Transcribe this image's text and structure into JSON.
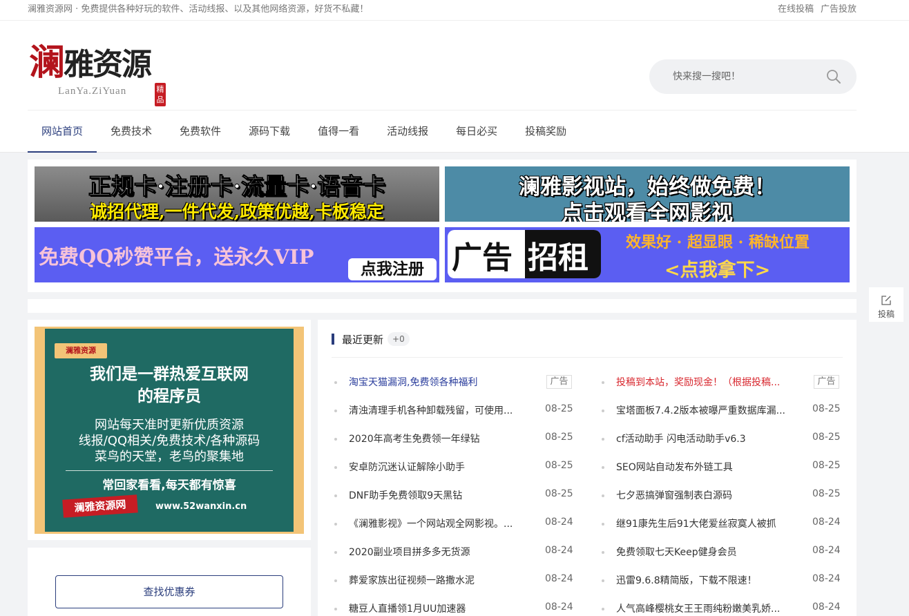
{
  "topbar": {
    "tagline": "澜雅资源网 · 免费提供各种好玩的软件、活动线报、以及其他网络资源，好货不私藏！",
    "links": [
      "在线投稿",
      "广告投放"
    ]
  },
  "logo": {
    "main_red": "澜",
    "main_rest": "雅资源",
    "sub": "LanYa.ZiYuan",
    "seal": "精品"
  },
  "search": {
    "placeholder": "快来搜一搜吧！"
  },
  "nav": [
    "网站首页",
    "免费技术",
    "免费软件",
    "源码下载",
    "值得一看",
    "活动线报",
    "每日必买",
    "投稿奖励"
  ],
  "banners": {
    "b1": {
      "line1": "正规卡·注册卡·流量卡·语音卡",
      "line2": "诚招代理,一件代发,政策优越,卡板稳定"
    },
    "b2": {
      "line1": "澜雅影视站，始终做免费！",
      "line2": "点击观看全网影视"
    },
    "b3": {
      "line1": "免费QQ秒赞平台，送永久VIP",
      "button": "点我注册"
    },
    "b4": {
      "t1": "广告",
      "t2": "招租",
      "r1": "效果好 · 超显眼 · 稀缺位置",
      "r2": "<点我拿下>"
    }
  },
  "promo": {
    "mini": "澜雅资源",
    "heading1": "我们是一群热爱互联网",
    "heading2": "的程序员",
    "line1": "网站每天准时更新优质资源",
    "line2": "线报/QQ相关/免费技术/各种源码",
    "line3": "菜鸟的天堂，老鸟的聚集地",
    "slogan": "常回家看看,每天都有惊喜",
    "brand": "澜雅资源网",
    "url": "www.52wanxin.cn"
  },
  "coupon": {
    "label": "查找优惠券"
  },
  "latest": {
    "title": "最近更新",
    "count": "+0",
    "left": [
      {
        "title": "淘宝天猫漏洞,免费领各种福利",
        "date": "广告",
        "style": "blue",
        "ad": true
      },
      {
        "title": "清浊清理手机各种卸载残留，可使用...",
        "date": "08-25"
      },
      {
        "title": "2020年高考生免费领一年绿钻",
        "date": "08-25"
      },
      {
        "title": "安卓防沉迷认证解除小助手",
        "date": "08-25"
      },
      {
        "title": "DNF助手免费领取9天黑钻",
        "date": "08-25"
      },
      {
        "title": "《澜雅影视》一个网站观全网影视。...",
        "date": "08-24"
      },
      {
        "title": "2020副业项目拼多多无货源",
        "date": "08-24"
      },
      {
        "title": "葬爱家族出征视频一路撒水泥",
        "date": "08-24"
      },
      {
        "title": "糖豆人直播领1月UU加速器",
        "date": "08-24"
      }
    ],
    "right": [
      {
        "title": "投稿到本站，奖励现金！（根据投稿...",
        "date": "广告",
        "style": "red",
        "ad": true
      },
      {
        "title": "宝塔面板7.4.2版本被曝严重数据库漏...",
        "date": "08-25"
      },
      {
        "title": "cf活动助手 闪电活动助手v6.3",
        "date": "08-25"
      },
      {
        "title": "SEO网站自动发布外链工具",
        "date": "08-25"
      },
      {
        "title": "七夕恶搞弹窗强制表白源码",
        "date": "08-25"
      },
      {
        "title": "继91康先生后91大佬爱丝寂寞人被抓",
        "date": "08-24"
      },
      {
        "title": "免费领取七天Keep健身会员",
        "date": "08-24"
      },
      {
        "title": "迅雷9.6.8精简版，下载不限速！",
        "date": "08-24"
      },
      {
        "title": "人气高峰樱桃女王王雨纯粉嫩美乳娇...",
        "date": "08-24"
      }
    ]
  },
  "float_btn": {
    "label": "投稿",
    "icon": "edit-icon"
  },
  "colors": {
    "accent": "#2a3d7c",
    "red": "#d8282f",
    "teal": "#1f6a63",
    "banner_blue": "#5b5ef2"
  }
}
